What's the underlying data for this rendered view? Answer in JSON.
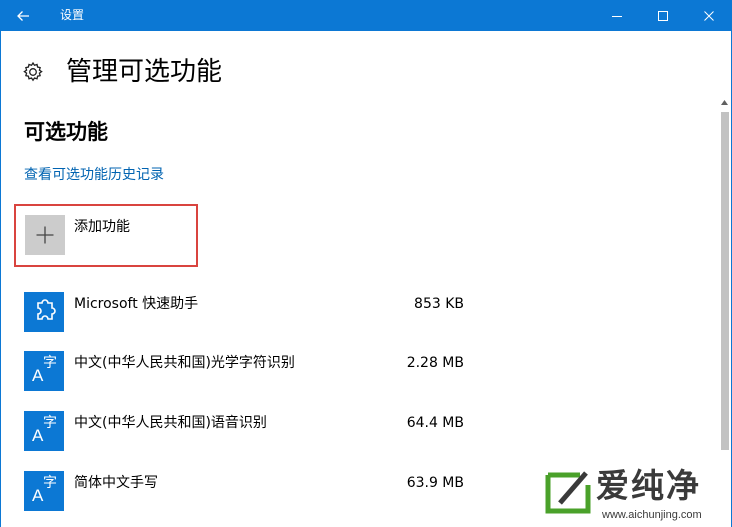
{
  "window": {
    "title": "设置",
    "back_icon": "arrow-left-icon",
    "minimize_icon": "minimize-icon",
    "maximize_icon": "maximize-icon",
    "close_icon": "close-icon",
    "accent": "#0c78d4"
  },
  "header": {
    "icon": "gear-icon",
    "title": "管理可选功能"
  },
  "section": {
    "title": "可选功能",
    "history_link": "查看可选功能历史记录",
    "link_color": "#0063b1"
  },
  "add_feature": {
    "icon": "plus-icon",
    "label": "添加功能",
    "highlight_color": "#d9443f"
  },
  "features": [
    {
      "icon": "puzzle-icon",
      "name": "Microsoft 快速助手",
      "size": "853 KB"
    },
    {
      "icon": "language-icon",
      "name": "中文(中华人民共和国)光学字符识别",
      "size": "2.28 MB"
    },
    {
      "icon": "language-icon",
      "name": "中文(中华人民共和国)语音识别",
      "size": "64.4 MB"
    },
    {
      "icon": "language-icon",
      "name": "简体中文手写",
      "size": "63.9 MB"
    }
  ],
  "language_icon_glyphs": {
    "a": "A",
    "zi": "字"
  },
  "watermark": {
    "text": "爱纯净",
    "url": "www.aichunjing.com"
  }
}
